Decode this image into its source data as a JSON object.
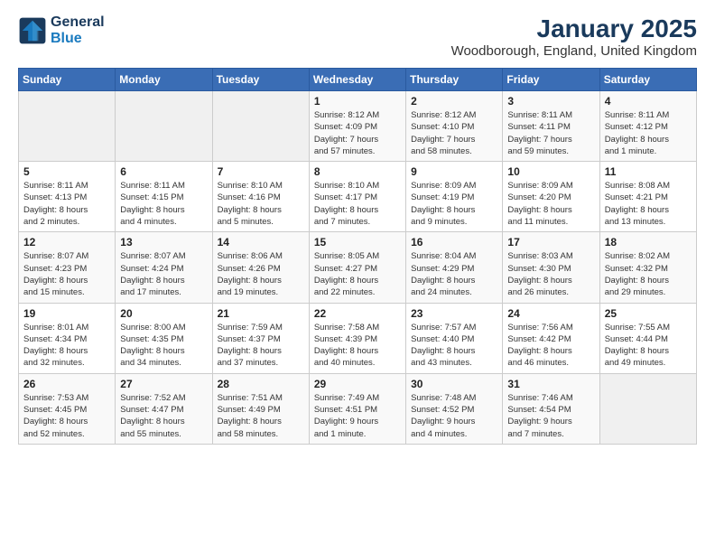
{
  "logo": {
    "line1": "General",
    "line2": "Blue"
  },
  "title": "January 2025",
  "location": "Woodborough, England, United Kingdom",
  "weekdays": [
    "Sunday",
    "Monday",
    "Tuesday",
    "Wednesday",
    "Thursday",
    "Friday",
    "Saturday"
  ],
  "weeks": [
    [
      {
        "day": "",
        "info": ""
      },
      {
        "day": "",
        "info": ""
      },
      {
        "day": "",
        "info": ""
      },
      {
        "day": "1",
        "info": "Sunrise: 8:12 AM\nSunset: 4:09 PM\nDaylight: 7 hours\nand 57 minutes."
      },
      {
        "day": "2",
        "info": "Sunrise: 8:12 AM\nSunset: 4:10 PM\nDaylight: 7 hours\nand 58 minutes."
      },
      {
        "day": "3",
        "info": "Sunrise: 8:11 AM\nSunset: 4:11 PM\nDaylight: 7 hours\nand 59 minutes."
      },
      {
        "day": "4",
        "info": "Sunrise: 8:11 AM\nSunset: 4:12 PM\nDaylight: 8 hours\nand 1 minute."
      }
    ],
    [
      {
        "day": "5",
        "info": "Sunrise: 8:11 AM\nSunset: 4:13 PM\nDaylight: 8 hours\nand 2 minutes."
      },
      {
        "day": "6",
        "info": "Sunrise: 8:11 AM\nSunset: 4:15 PM\nDaylight: 8 hours\nand 4 minutes."
      },
      {
        "day": "7",
        "info": "Sunrise: 8:10 AM\nSunset: 4:16 PM\nDaylight: 8 hours\nand 5 minutes."
      },
      {
        "day": "8",
        "info": "Sunrise: 8:10 AM\nSunset: 4:17 PM\nDaylight: 8 hours\nand 7 minutes."
      },
      {
        "day": "9",
        "info": "Sunrise: 8:09 AM\nSunset: 4:19 PM\nDaylight: 8 hours\nand 9 minutes."
      },
      {
        "day": "10",
        "info": "Sunrise: 8:09 AM\nSunset: 4:20 PM\nDaylight: 8 hours\nand 11 minutes."
      },
      {
        "day": "11",
        "info": "Sunrise: 8:08 AM\nSunset: 4:21 PM\nDaylight: 8 hours\nand 13 minutes."
      }
    ],
    [
      {
        "day": "12",
        "info": "Sunrise: 8:07 AM\nSunset: 4:23 PM\nDaylight: 8 hours\nand 15 minutes."
      },
      {
        "day": "13",
        "info": "Sunrise: 8:07 AM\nSunset: 4:24 PM\nDaylight: 8 hours\nand 17 minutes."
      },
      {
        "day": "14",
        "info": "Sunrise: 8:06 AM\nSunset: 4:26 PM\nDaylight: 8 hours\nand 19 minutes."
      },
      {
        "day": "15",
        "info": "Sunrise: 8:05 AM\nSunset: 4:27 PM\nDaylight: 8 hours\nand 22 minutes."
      },
      {
        "day": "16",
        "info": "Sunrise: 8:04 AM\nSunset: 4:29 PM\nDaylight: 8 hours\nand 24 minutes."
      },
      {
        "day": "17",
        "info": "Sunrise: 8:03 AM\nSunset: 4:30 PM\nDaylight: 8 hours\nand 26 minutes."
      },
      {
        "day": "18",
        "info": "Sunrise: 8:02 AM\nSunset: 4:32 PM\nDaylight: 8 hours\nand 29 minutes."
      }
    ],
    [
      {
        "day": "19",
        "info": "Sunrise: 8:01 AM\nSunset: 4:34 PM\nDaylight: 8 hours\nand 32 minutes."
      },
      {
        "day": "20",
        "info": "Sunrise: 8:00 AM\nSunset: 4:35 PM\nDaylight: 8 hours\nand 34 minutes."
      },
      {
        "day": "21",
        "info": "Sunrise: 7:59 AM\nSunset: 4:37 PM\nDaylight: 8 hours\nand 37 minutes."
      },
      {
        "day": "22",
        "info": "Sunrise: 7:58 AM\nSunset: 4:39 PM\nDaylight: 8 hours\nand 40 minutes."
      },
      {
        "day": "23",
        "info": "Sunrise: 7:57 AM\nSunset: 4:40 PM\nDaylight: 8 hours\nand 43 minutes."
      },
      {
        "day": "24",
        "info": "Sunrise: 7:56 AM\nSunset: 4:42 PM\nDaylight: 8 hours\nand 46 minutes."
      },
      {
        "day": "25",
        "info": "Sunrise: 7:55 AM\nSunset: 4:44 PM\nDaylight: 8 hours\nand 49 minutes."
      }
    ],
    [
      {
        "day": "26",
        "info": "Sunrise: 7:53 AM\nSunset: 4:45 PM\nDaylight: 8 hours\nand 52 minutes."
      },
      {
        "day": "27",
        "info": "Sunrise: 7:52 AM\nSunset: 4:47 PM\nDaylight: 8 hours\nand 55 minutes."
      },
      {
        "day": "28",
        "info": "Sunrise: 7:51 AM\nSunset: 4:49 PM\nDaylight: 8 hours\nand 58 minutes."
      },
      {
        "day": "29",
        "info": "Sunrise: 7:49 AM\nSunset: 4:51 PM\nDaylight: 9 hours\nand 1 minute."
      },
      {
        "day": "30",
        "info": "Sunrise: 7:48 AM\nSunset: 4:52 PM\nDaylight: 9 hours\nand 4 minutes."
      },
      {
        "day": "31",
        "info": "Sunrise: 7:46 AM\nSunset: 4:54 PM\nDaylight: 9 hours\nand 7 minutes."
      },
      {
        "day": "",
        "info": ""
      }
    ]
  ]
}
